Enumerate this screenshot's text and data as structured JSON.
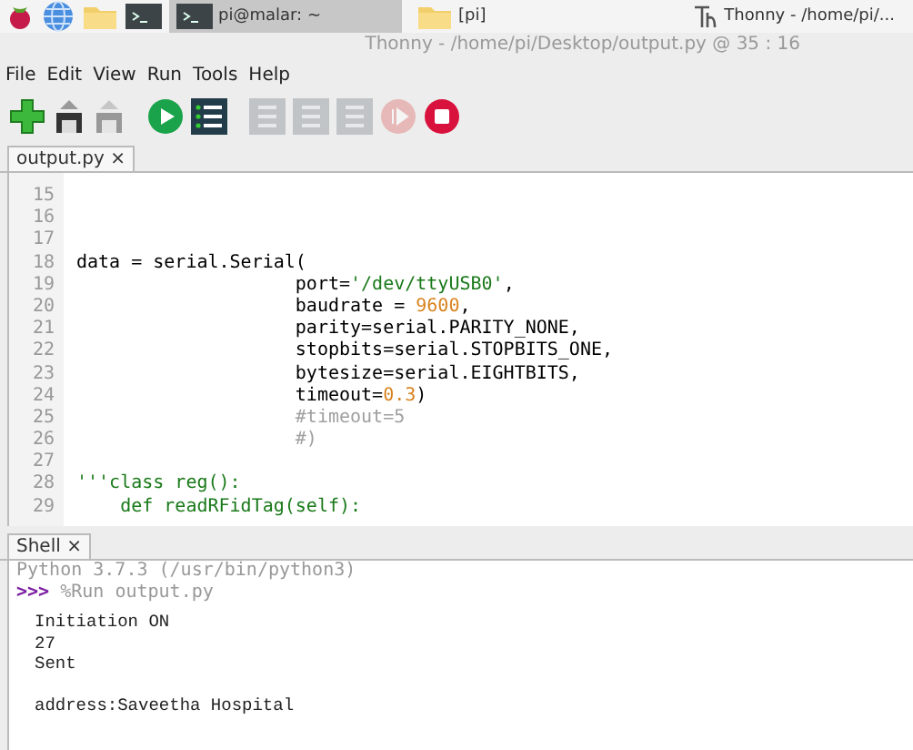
{
  "taskbar": {
    "launchers": [
      {
        "kind": "raspberry"
      },
      {
        "kind": "globe"
      },
      {
        "kind": "folder"
      },
      {
        "kind": "terminal"
      }
    ],
    "windows": [
      {
        "label": "pi@malar: ~",
        "kind": "terminal",
        "selected": true
      },
      {
        "label": "[pi]",
        "kind": "folder",
        "selected": false
      },
      {
        "label": "Thonny  -  /home/pi/...",
        "kind": "thonny",
        "selected": false
      }
    ]
  },
  "window": {
    "title": "Thonny  -  /home/pi/Desktop/output.py  @  35 : 16"
  },
  "menu": [
    "File",
    "Edit",
    "View",
    "Run",
    "Tools",
    "Help"
  ],
  "toolbar": [
    {
      "kind": "new",
      "disabled": false
    },
    {
      "kind": "load",
      "disabled": false
    },
    {
      "kind": "save",
      "disabled": true
    },
    {
      "kind": "run",
      "disabled": false
    },
    {
      "kind": "debug",
      "disabled": false
    },
    {
      "kind": "step",
      "disabled": true
    },
    {
      "kind": "step",
      "disabled": true
    },
    {
      "kind": "step",
      "disabled": true
    },
    {
      "kind": "resume",
      "disabled": true
    },
    {
      "kind": "stop",
      "disabled": false
    }
  ],
  "editor": {
    "tab": "output.py ×",
    "lines": [
      {
        "n": "15"
      },
      {
        "n": "16"
      },
      {
        "n": "17"
      },
      {
        "n": "18",
        "segments": [
          {
            "kind": "plain",
            "text": "data = serial.Serial("
          }
        ]
      },
      {
        "n": "19",
        "segments": [
          {
            "kind": "plain",
            "text": "                    port="
          },
          {
            "kind": "string",
            "text": "'/dev/ttyUSB0'"
          },
          {
            "kind": "plain",
            "text": ","
          }
        ]
      },
      {
        "n": "20",
        "segments": [
          {
            "kind": "plain",
            "text": "                    baudrate = "
          },
          {
            "kind": "number",
            "text": "9600"
          },
          {
            "kind": "plain",
            "text": ","
          }
        ]
      },
      {
        "n": "21",
        "segments": [
          {
            "kind": "plain",
            "text": "                    parity=serial.PARITY_NONE,"
          }
        ]
      },
      {
        "n": "22",
        "segments": [
          {
            "kind": "plain",
            "text": "                    stopbits=serial.STOPBITS_ONE,"
          }
        ]
      },
      {
        "n": "23",
        "segments": [
          {
            "kind": "plain",
            "text": "                    bytesize=serial.EIGHTBITS,"
          }
        ]
      },
      {
        "n": "24",
        "segments": [
          {
            "kind": "plain",
            "text": "                    timeout="
          },
          {
            "kind": "number",
            "text": "0.3"
          },
          {
            "kind": "plain",
            "text": ")"
          }
        ]
      },
      {
        "n": "25",
        "segments": [
          {
            "kind": "comment",
            "text": "                    #timeout=5"
          }
        ]
      },
      {
        "n": "26",
        "segments": [
          {
            "kind": "comment",
            "text": "                    #)"
          }
        ]
      },
      {
        "n": "27"
      },
      {
        "n": "28",
        "segments": [
          {
            "kind": "string",
            "text": "'''class reg():"
          }
        ]
      },
      {
        "n": "29",
        "segments": [
          {
            "kind": "string",
            "text": "    def readRFidTag(self):"
          }
        ]
      }
    ]
  },
  "shell": {
    "tab": "Shell ×",
    "banner": "Python 3.7.3 (/usr/bin/python3)",
    "prompt": ">>>",
    "command": "%Run output.py",
    "output_blocks": [
      {
        "lines": [
          "Initiation ON",
          "27",
          "Sent"
        ]
      },
      {
        "lines": [
          "address:Saveetha Hospital"
        ]
      }
    ]
  }
}
